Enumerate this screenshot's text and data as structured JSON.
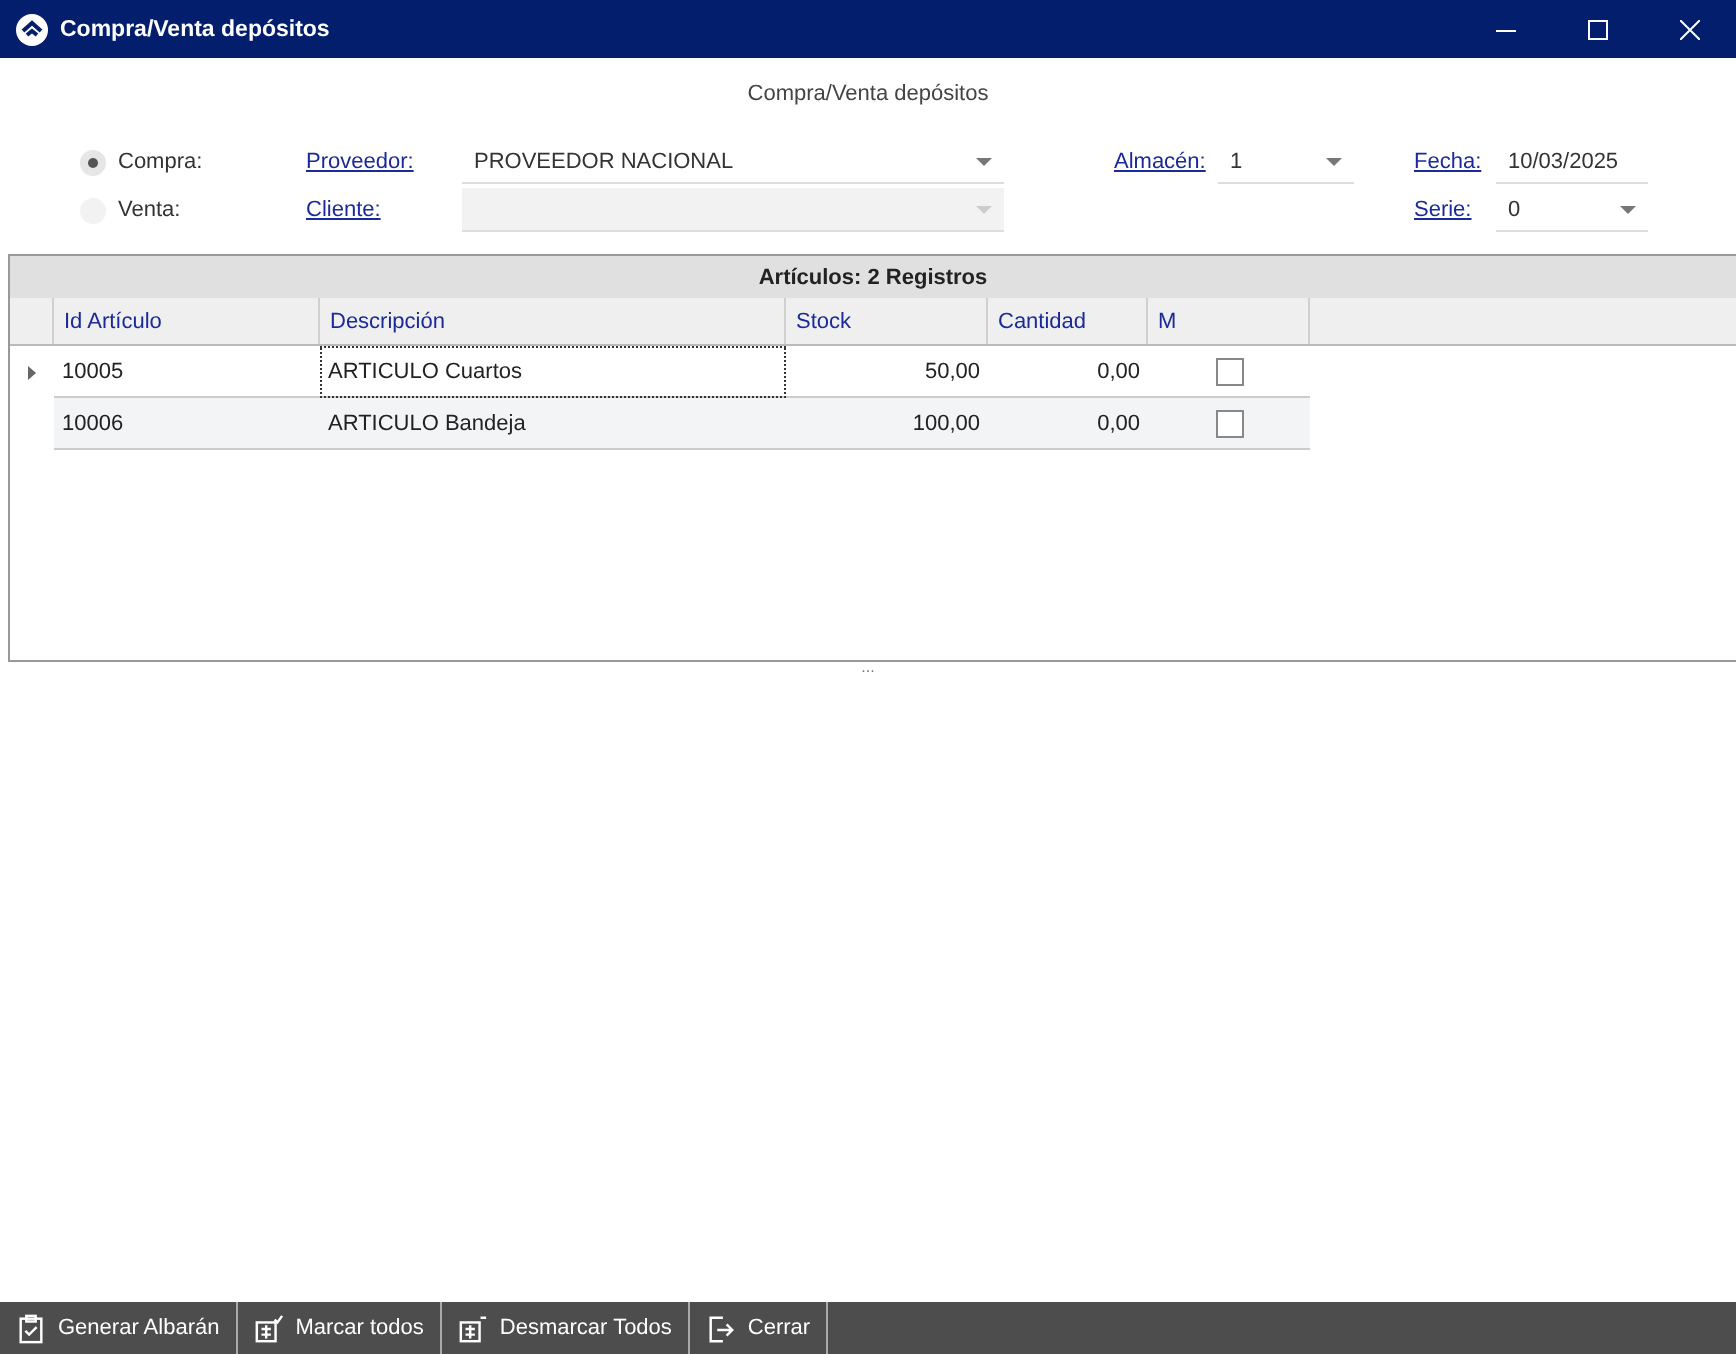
{
  "window": {
    "title": "Compra/Venta depósitos"
  },
  "heading": "Compra/Venta depósitos",
  "form": {
    "modes": [
      {
        "label": "Compra:",
        "selected": true
      },
      {
        "label": "Venta:",
        "selected": false
      }
    ],
    "party_fields": [
      {
        "label": "Proveedor:",
        "value": "PROVEEDOR NACIONAL",
        "disabled": false
      },
      {
        "label": "Cliente:",
        "disabled": true
      }
    ],
    "almacen": {
      "label": "Almacén:",
      "value": "1"
    },
    "fecha": {
      "label": "Fecha:",
      "value": "10/03/2025"
    },
    "serie": {
      "label": "Serie:",
      "value": "0"
    }
  },
  "grid": {
    "caption": "Artículos: 2 Registros",
    "columns": [
      {
        "label": "Id Artículo"
      },
      {
        "label": "Descripción"
      },
      {
        "label": "Stock"
      },
      {
        "label": "Cantidad"
      },
      {
        "label": "M"
      }
    ],
    "rows": [
      {
        "selected": true,
        "id": "10005",
        "description": "ARTICULO Cuartos",
        "stock": "50,00",
        "quantity": "0,00",
        "checked": false
      },
      {
        "selected": false,
        "id": "10006",
        "description": "ARTICULO Bandeja",
        "stock": "100,00",
        "quantity": "0,00",
        "checked": false
      }
    ]
  },
  "splitter": "...",
  "toolbar": [
    {
      "kind": "clipboard",
      "label": "Generar Albarán"
    },
    {
      "kind": "check-all",
      "label": "Marcar todos"
    },
    {
      "kind": "uncheck-all",
      "label": "Desmarcar Todos"
    },
    {
      "kind": "exit",
      "label": "Cerrar"
    }
  ]
}
